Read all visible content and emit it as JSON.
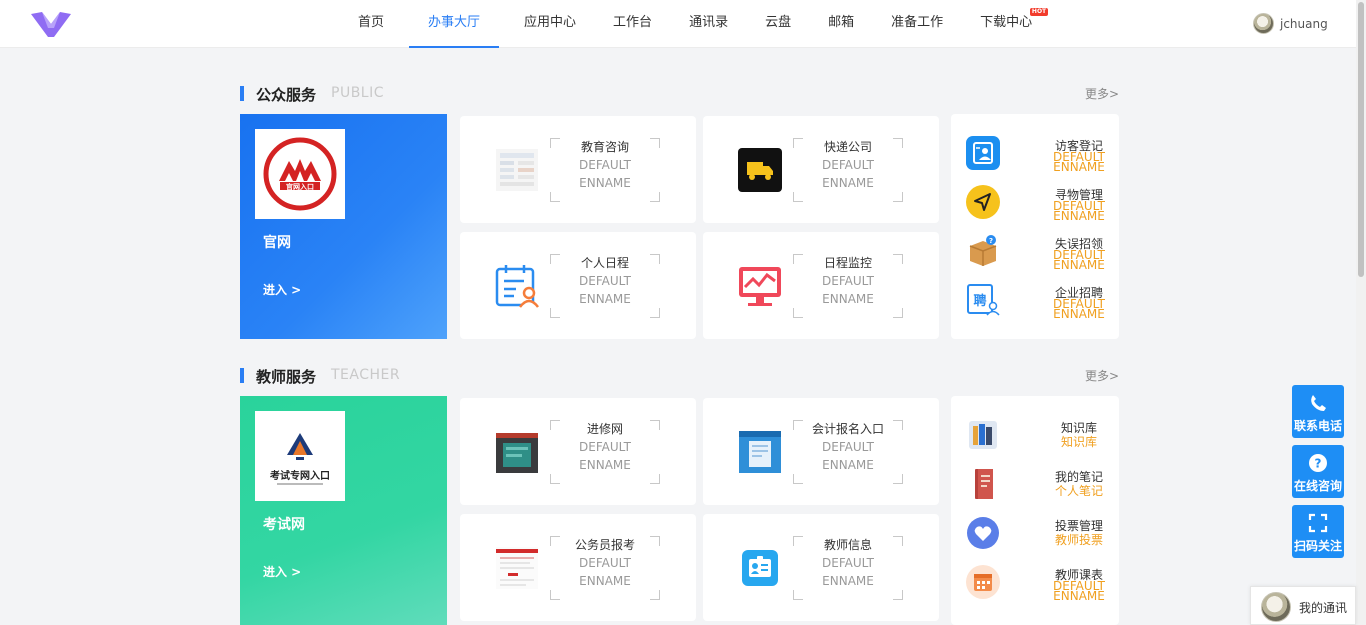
{
  "header": {
    "nav": [
      {
        "label": "首页"
      },
      {
        "label": "办事大厅",
        "active": true
      },
      {
        "label": "应用中心"
      },
      {
        "label": "工作台"
      },
      {
        "label": "通讯录"
      },
      {
        "label": "云盘"
      },
      {
        "label": "邮箱"
      },
      {
        "label": "准备工作"
      },
      {
        "label": "下载中心",
        "badge": "HOT"
      }
    ],
    "user_name": "jchuang"
  },
  "public": {
    "title": "公众服务",
    "en": "PUBLIC",
    "more": "更多>",
    "banner": {
      "logo_text": "官网入口",
      "name": "官网",
      "enter": "进入 >"
    },
    "cards": [
      {
        "cn": "教育咨询",
        "en1": "DEFAULT",
        "en2": "ENNAME",
        "icon": "document-thumbnail-icon"
      },
      {
        "cn": "快递公司",
        "en1": "DEFAULT",
        "en2": "ENNAME",
        "icon": "delivery-truck-icon"
      },
      {
        "cn": "个人日程",
        "en1": "DEFAULT",
        "en2": "ENNAME",
        "icon": "schedule-person-icon"
      },
      {
        "cn": "日程监控",
        "en1": "DEFAULT",
        "en2": "ENNAME",
        "icon": "monitor-chart-icon"
      }
    ],
    "side": [
      {
        "cn": "访客登记",
        "en1": "DEFAULT",
        "en2": "ENNAME",
        "icon": "visitor-card-icon"
      },
      {
        "cn": "寻物管理",
        "en1": "DEFAULT",
        "en2": "ENNAME",
        "icon": "paper-plane-icon"
      },
      {
        "cn": "失误招领",
        "en1": "DEFAULT",
        "en2": "ENNAME",
        "icon": "package-box-icon"
      },
      {
        "cn": "企业招聘",
        "en1": "DEFAULT",
        "en2": "ENNAME",
        "icon": "recruit-icon"
      }
    ]
  },
  "teacher": {
    "title": "教师服务",
    "en": "TEACHER",
    "more": "更多>",
    "banner": {
      "logo_text": "考试专网入口",
      "name": "考试网",
      "enter": "进入 >"
    },
    "cards": [
      {
        "cn": "进修网",
        "en1": "DEFAULT",
        "en2": "ENNAME",
        "icon": "training-site-thumbnail-icon"
      },
      {
        "cn": "会计报名入口",
        "en1": "DEFAULT",
        "en2": "ENNAME",
        "icon": "accounting-site-thumbnail-icon"
      },
      {
        "cn": "公务员报考",
        "en1": "DEFAULT",
        "en2": "ENNAME",
        "icon": "exam-site-thumbnail-icon"
      },
      {
        "cn": "教师信息",
        "en1": "DEFAULT",
        "en2": "ENNAME",
        "icon": "id-card-icon"
      }
    ],
    "side": [
      {
        "cn": "知识库",
        "en": "知识库",
        "icon": "books-icon"
      },
      {
        "cn": "我的笔记",
        "en": "个人笔记",
        "icon": "notebook-icon"
      },
      {
        "cn": "投票管理",
        "en": "教师投票",
        "icon": "heart-vote-icon"
      },
      {
        "cn": "教师课表",
        "en1": "DEFAULT",
        "en2": "ENNAME",
        "icon": "calendar-icon"
      }
    ]
  },
  "floating": [
    {
      "label": "联系电话",
      "icon": "phone-icon"
    },
    {
      "label": "在线咨询",
      "icon": "question-icon"
    },
    {
      "label": "扫码关注",
      "icon": "scan-icon"
    }
  ],
  "chat": {
    "label": "我的通讯"
  },
  "colors": {
    "accent": "#2a7ef4",
    "public_banner": "#1f78f2",
    "teacher_banner": "#2ed49e",
    "orange": "#f0a020",
    "float_btn": "#1e8ef5"
  }
}
